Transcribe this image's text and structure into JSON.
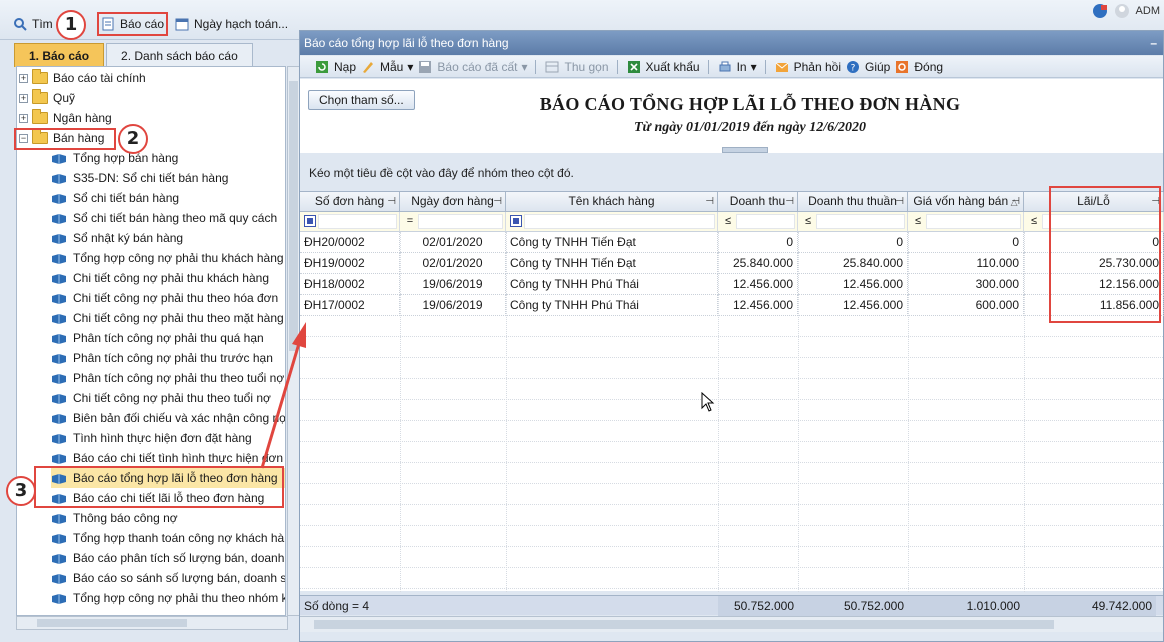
{
  "topbar": {
    "search_label": "Tìm",
    "report_label": "Báo cáo",
    "posting_date_label": "Ngày hạch toán...",
    "user_label": "ADM"
  },
  "left": {
    "tabs": [
      {
        "label": "1. Báo cáo",
        "active": true
      },
      {
        "label": "2. Danh sách báo cáo",
        "active": false
      }
    ],
    "groups": [
      {
        "label": "Báo cáo tài chính",
        "expander": "+"
      },
      {
        "label": "Quỹ",
        "expander": "+"
      },
      {
        "label": "Ngân hàng",
        "expander": "+"
      },
      {
        "label": "Bán hàng",
        "expander": "−"
      }
    ],
    "items": [
      "Tổng hợp bán hàng",
      "S35-DN: Sổ chi tiết bán hàng",
      "Sổ chi tiết bán hàng",
      "Sổ chi tiết bán hàng theo mã quy cách",
      "Sổ nhật ký bán hàng",
      "Tổng hợp công nợ phải thu khách hàng",
      "Chi tiết công nợ phải thu khách hàng",
      "Chi tiết công nợ phải thu theo hóa đơn",
      "Chi tiết công nợ phải thu theo mặt hàng",
      "Phân tích công nợ phải thu quá hạn",
      "Phân tích công nợ phải thu trước hạn",
      "Phân tích công nợ phải thu theo tuổi nợ",
      "Chi tiết công nợ phải thu theo tuổi nợ",
      "Biên bản đối chiếu và xác nhận công nợ",
      "Tình hình thực hiện đơn đặt hàng",
      "Báo cáo chi tiết tình hình thực hiện đơn đ",
      "Báo cáo tổng hợp lãi lỗ theo đơn hàng",
      "Báo cáo chi tiết lãi lỗ theo đơn hàng",
      "Thông báo công nợ",
      "Tổng hợp thanh toán công nợ khách hàn",
      "Báo cáo phân tích số lượng bán, doanh s",
      "Báo cáo so sánh số lượng bán, doanh số",
      "Tổng hợp công nợ phải thu theo nhóm k"
    ]
  },
  "window": {
    "title": "Báo cáo tổng hợp lãi lỗ theo đơn hàng",
    "minimize_glyph": "–",
    "toolbar": {
      "refresh": "Nạp",
      "template": "Mẫu",
      "saved_reports": "Báo cáo đã cất",
      "collapse": "Thu gọn",
      "export": "Xuất khẩu",
      "print": "In",
      "feedback": "Phản hồi",
      "help": "Giúp",
      "close": "Đóng"
    },
    "param_button": "Chọn tham số...",
    "report_title": "BÁO CÁO TỔNG HỢP LÃI LỖ THEO ĐƠN HÀNG",
    "report_subtitle": "Từ ngày 01/01/2019 đến ngày 12/6/2020",
    "group_hint": "Kéo một tiêu đề cột vào đây để nhóm theo cột đó."
  },
  "grid": {
    "columns": [
      "Số đơn hàng",
      "Ngày đơn hàng",
      "Tên khách hàng",
      "Doanh thu",
      "Doanh thu thuần",
      "Giá vốn hàng bán",
      "Lãi/Lỗ"
    ],
    "filter_symbols": [
      "",
      "=",
      "",
      "≤",
      "≤",
      "≤",
      "≤"
    ],
    "rows": [
      [
        "ĐH20/0002",
        "02/01/2020",
        "Công ty TNHH Tiến Đạt",
        "0",
        "0",
        "0",
        "0"
      ],
      [
        "ĐH19/0002",
        "02/01/2020",
        "Công ty TNHH Tiến Đạt",
        "25.840.000",
        "25.840.000",
        "110.000",
        "25.730.000"
      ],
      [
        "ĐH18/0002",
        "19/06/2019",
        "Công ty TNHH Phú Thái",
        "12.456.000",
        "12.456.000",
        "300.000",
        "12.156.000"
      ],
      [
        "ĐH17/0002",
        "19/06/2019",
        "Công ty TNHH Phú Thái",
        "12.456.000",
        "12.456.000",
        "600.000",
        "11.856.000"
      ]
    ],
    "footer": {
      "row_count": "Số dòng = 4",
      "revenue": "50.752.000",
      "net_revenue": "50.752.000",
      "cogs": "1.010.000",
      "profit": "49.742.000"
    }
  },
  "annotations": [
    "1",
    "2",
    "3"
  ],
  "colors": {
    "highlight": "#e0463f",
    "active_tab": "#f5c55a",
    "title_bar": "#6a89b6"
  }
}
